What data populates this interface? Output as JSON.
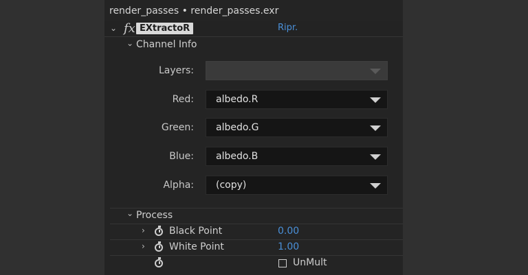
{
  "header": {
    "title": "render_passes • render_passes.exr"
  },
  "effect": {
    "fx_symbol": "fx",
    "name": "EXtractoR",
    "link_label": "Ripr."
  },
  "channel_info": {
    "heading": "Channel Info",
    "rows": [
      {
        "label": "Layers:",
        "value": "",
        "disabled": true
      },
      {
        "label": "Red:",
        "value": "albedo.R",
        "disabled": false
      },
      {
        "label": "Green:",
        "value": "albedo.G",
        "disabled": false
      },
      {
        "label": "Blue:",
        "value": "albedo.B",
        "disabled": false
      },
      {
        "label": "Alpha:",
        "value": "(copy)",
        "disabled": false
      }
    ]
  },
  "process": {
    "heading": "Process",
    "black_point": {
      "label": "Black Point",
      "value": "0.00"
    },
    "white_point": {
      "label": "White Point",
      "value": "1.00"
    },
    "unmult": {
      "label": "UnMult",
      "checked": false
    }
  },
  "icons": {
    "expand": "chevron-down-icon",
    "collapse": "chevron-right-icon",
    "stopwatch": "stopwatch-icon",
    "dropdown": "triangle-down-icon"
  },
  "colors": {
    "link": "#4a90d9",
    "panel": "#242424"
  }
}
